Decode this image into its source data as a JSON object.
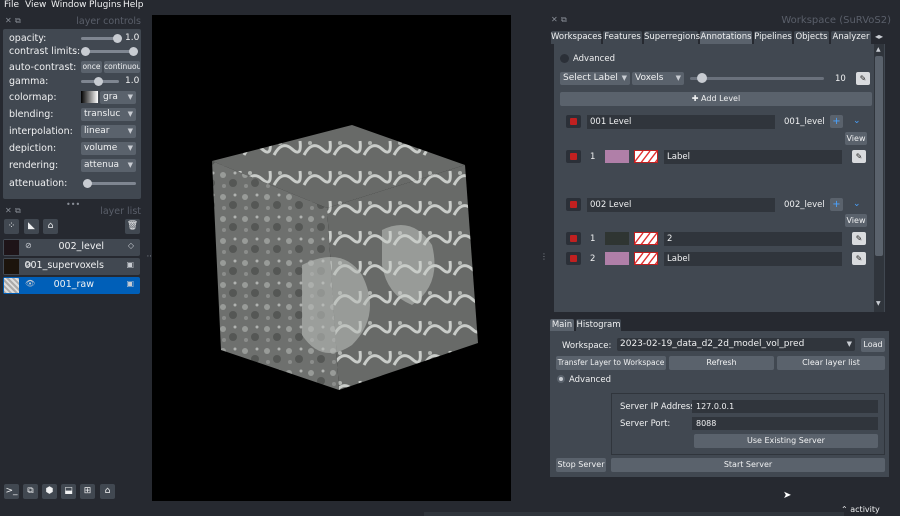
{
  "menu": [
    "File",
    "View",
    "Window",
    "Plugins",
    "Help"
  ],
  "layer_controls": {
    "title": "layer controls",
    "opacity_label": "opacity:",
    "opacity_value": "1.0",
    "opacity_level": 1.0,
    "contrast_label": "contrast limits:",
    "auto_contrast_label": "auto-contrast:",
    "once_label": "once",
    "continuous_label": "continuou",
    "gamma_label": "gamma:",
    "gamma_value": "1.0",
    "colormap_label": "colormap:",
    "colormap_value": "gra",
    "blending_label": "blending:",
    "blending_value": "transluc",
    "interpolation_label": "interpolation:",
    "interpolation_value": "linear",
    "depiction_label": "depiction:",
    "depiction_value": "volume",
    "rendering_label": "rendering:",
    "rendering_value": "attenua",
    "attenuation_label": "attenuation:"
  },
  "layer_list": {
    "title": "layer list",
    "layers": [
      {
        "name": "002_level",
        "kind": "labels",
        "selected": false
      },
      {
        "name": "001_supervoxels",
        "kind": "image",
        "selected": false
      },
      {
        "name": "001_raw",
        "kind": "image",
        "selected": true
      }
    ]
  },
  "workspace_title": "Workspace (SuRVoS2)",
  "tabs": [
    "Workspaces",
    "Features",
    "Superregions",
    "Annotations",
    "Pipelines",
    "Objects",
    "Analyzer"
  ],
  "active_tab": "Annotations",
  "annotations": {
    "advanced_label": "Advanced",
    "select_label": "Select Label",
    "voxels_label": "Voxels",
    "brush_value": "10",
    "add_level_label": "Add Level",
    "levels": [
      {
        "name": "001 Level",
        "id": "001_level",
        "view_label": "View",
        "labels": [
          {
            "index": "1",
            "name": "Label",
            "color": "#b07fa8"
          }
        ]
      },
      {
        "name": "002 Level",
        "id": "002_level",
        "view_label": "View",
        "labels": [
          {
            "index": "1",
            "name": "2",
            "color": "#2f3532"
          },
          {
            "index": "2",
            "name": "Label",
            "color": "#b07fa8"
          }
        ]
      }
    ]
  },
  "bottom_tabs": [
    "Main",
    "Histogram"
  ],
  "main": {
    "workspace_label": "Workspace:",
    "workspace_value": "2023-02-19_data_d2_2d_model_vol_pred",
    "load_label": "Load",
    "transfer_label": "Transfer Layer to Workspace",
    "refresh_label": "Refresh",
    "clear_label": "Clear layer list",
    "advanced_label": "Advanced",
    "server_ip_label": "Server IP Address:",
    "server_ip_value": "127.0.0.1",
    "server_port_label": "Server Port:",
    "server_port_value": "8088",
    "use_existing_label": "Use Existing Server",
    "stop_label": "Stop Server",
    "start_label": "Start Server"
  },
  "status": {
    "activity_label": "activity"
  }
}
